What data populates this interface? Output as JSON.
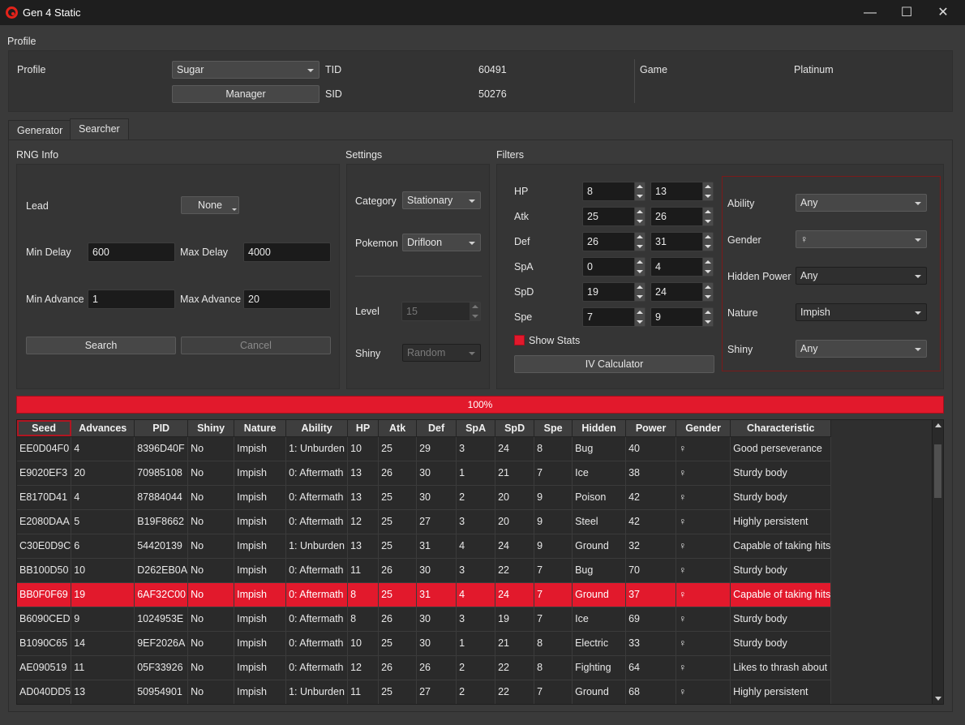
{
  "window": {
    "title": "Gen 4 Static",
    "minimize": "—",
    "maximize": "☐",
    "close": "✕"
  },
  "profile": {
    "section_title": "Profile",
    "profile_label": "Profile",
    "profile_value": "Sugar",
    "manager_button": "Manager",
    "tid_label": "TID",
    "tid_value": "60491",
    "sid_label": "SID",
    "sid_value": "50276",
    "game_label": "Game",
    "game_value": "Platinum"
  },
  "tabs": [
    {
      "label": "Generator",
      "active": false
    },
    {
      "label": "Searcher",
      "active": true
    }
  ],
  "rng_info": {
    "title": "RNG Info",
    "lead_label": "Lead",
    "lead_value": "None",
    "min_delay_label": "Min Delay",
    "min_delay_value": "600",
    "max_delay_label": "Max Delay",
    "max_delay_value": "4000",
    "min_advance_label": "Min Advance",
    "min_advance_value": "1",
    "max_advance_label": "Max Advance",
    "max_advance_value": "20",
    "search_button": "Search",
    "cancel_button": "Cancel"
  },
  "settings": {
    "title": "Settings",
    "category_label": "Category",
    "category_value": "Stationary",
    "pokemon_label": "Pokemon",
    "pokemon_value": "Drifloon",
    "level_label": "Level",
    "level_value": "15",
    "shiny_label": "Shiny",
    "shiny_value": "Random"
  },
  "filters": {
    "title": "Filters",
    "ivs": [
      {
        "label": "HP",
        "min": "8",
        "max": "13"
      },
      {
        "label": "Atk",
        "min": "25",
        "max": "26"
      },
      {
        "label": "Def",
        "min": "26",
        "max": "31"
      },
      {
        "label": "SpA",
        "min": "0",
        "max": "4"
      },
      {
        "label": "SpD",
        "min": "19",
        "max": "24"
      },
      {
        "label": "Spe",
        "min": "7",
        "max": "9"
      }
    ],
    "show_stats_label": "Show Stats",
    "iv_calculator_button": "IV Calculator",
    "ability_label": "Ability",
    "ability_value": "Any",
    "gender_label": "Gender",
    "gender_value": "♀",
    "hidden_power_label": "Hidden Power",
    "hidden_power_value": "Any",
    "nature_label": "Nature",
    "nature_value": "Impish",
    "shiny_label": "Shiny",
    "shiny_value": "Any"
  },
  "progress": {
    "label": "100%",
    "value": 1.0
  },
  "results": {
    "columns": [
      "Seed",
      "Advances",
      "PID",
      "Shiny",
      "Nature",
      "Ability",
      "HP",
      "Atk",
      "Def",
      "SpA",
      "SpD",
      "Spe",
      "Hidden",
      "Power",
      "Gender",
      "Characteristic"
    ],
    "rows": [
      [
        "EE0D04F0",
        "4",
        "8396D40F",
        "No",
        "Impish",
        "1: Unburden",
        "10",
        "25",
        "29",
        "3",
        "24",
        "8",
        "Bug",
        "40",
        "♀",
        "Good perseverance"
      ],
      [
        "E9020EF3",
        "20",
        "70985108",
        "No",
        "Impish",
        "0: Aftermath",
        "13",
        "26",
        "30",
        "1",
        "21",
        "7",
        "Ice",
        "38",
        "♀",
        "Sturdy body"
      ],
      [
        "E8170D41",
        "4",
        "87884044",
        "No",
        "Impish",
        "0: Aftermath",
        "13",
        "25",
        "30",
        "2",
        "20",
        "9",
        "Poison",
        "42",
        "♀",
        "Sturdy body"
      ],
      [
        "E2080DAA",
        "5",
        "B19F8662",
        "No",
        "Impish",
        "0: Aftermath",
        "12",
        "25",
        "27",
        "3",
        "20",
        "9",
        "Steel",
        "42",
        "♀",
        "Highly persistent"
      ],
      [
        "C30E0D9C",
        "6",
        "54420139",
        "No",
        "Impish",
        "1: Unburden",
        "13",
        "25",
        "31",
        "4",
        "24",
        "9",
        "Ground",
        "32",
        "♀",
        "Capable of taking hits"
      ],
      [
        "BB100D50",
        "10",
        "D262EB0A",
        "No",
        "Impish",
        "0: Aftermath",
        "11",
        "26",
        "30",
        "3",
        "22",
        "7",
        "Bug",
        "70",
        "♀",
        "Sturdy body"
      ],
      [
        "BB0F0F69",
        "19",
        "6AF32C00",
        "No",
        "Impish",
        "0: Aftermath",
        "8",
        "25",
        "31",
        "4",
        "24",
        "7",
        "Ground",
        "37",
        "♀",
        "Capable of taking hits"
      ],
      [
        "B6090CED",
        "9",
        "1024953E",
        "No",
        "Impish",
        "0: Aftermath",
        "8",
        "26",
        "30",
        "3",
        "19",
        "7",
        "Ice",
        "69",
        "♀",
        "Sturdy body"
      ],
      [
        "B1090C65",
        "14",
        "9EF2026A",
        "No",
        "Impish",
        "0: Aftermath",
        "10",
        "25",
        "30",
        "1",
        "21",
        "8",
        "Electric",
        "33",
        "♀",
        "Sturdy body"
      ],
      [
        "AE090519",
        "11",
        "05F33926",
        "No",
        "Impish",
        "0: Aftermath",
        "12",
        "26",
        "26",
        "2",
        "22",
        "8",
        "Fighting",
        "64",
        "♀",
        "Likes to thrash about"
      ],
      [
        "AD040DD5",
        "13",
        "50954901",
        "No",
        "Impish",
        "1: Unburden",
        "11",
        "25",
        "27",
        "2",
        "22",
        "7",
        "Ground",
        "68",
        "♀",
        "Highly persistent"
      ]
    ],
    "selected_row": 6
  }
}
